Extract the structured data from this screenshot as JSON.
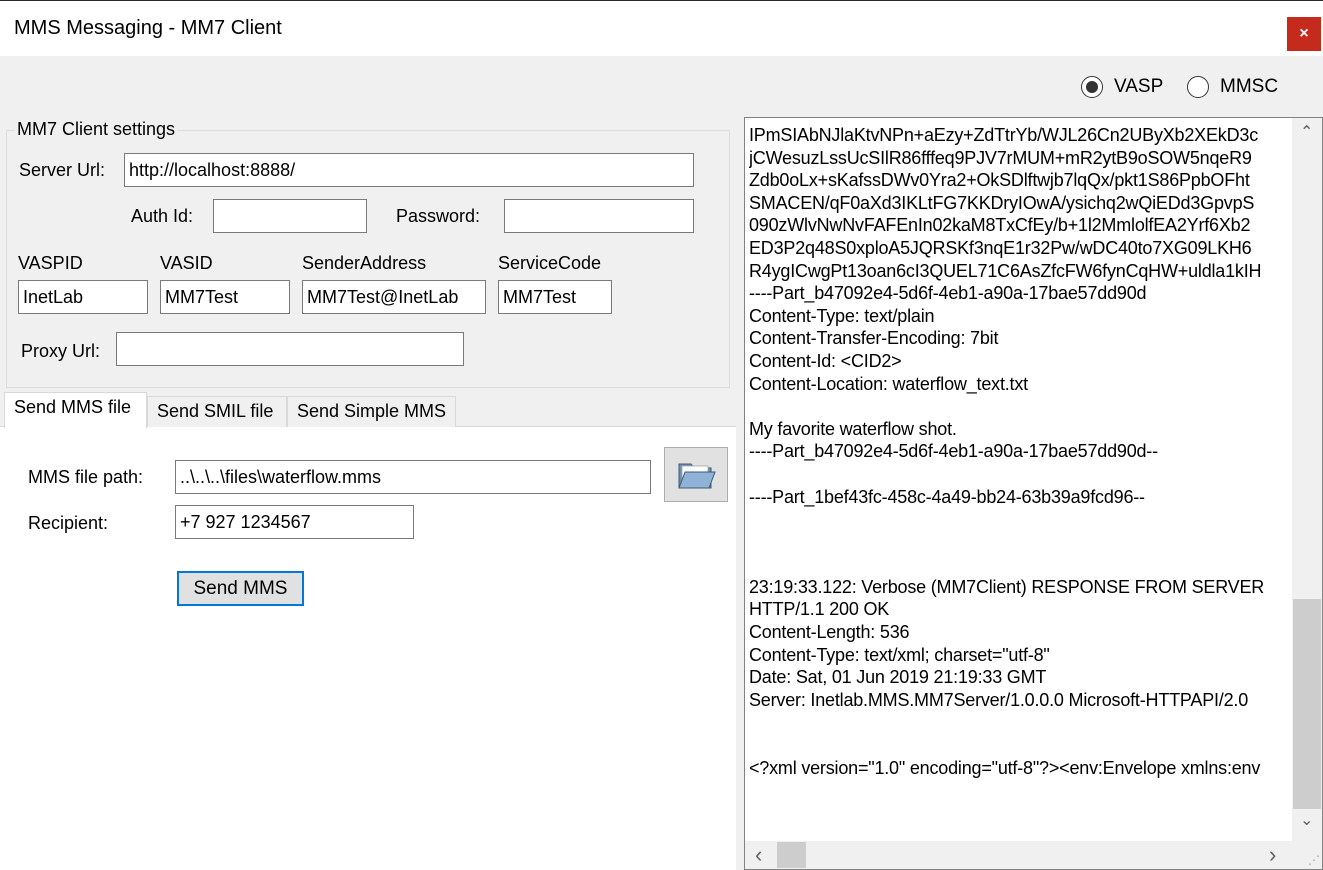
{
  "window": {
    "title": "MMS Messaging - MM7 Client",
    "close_glyph": "×"
  },
  "mode": {
    "selected": "VASP",
    "options": [
      {
        "label": "VASP",
        "checked": true
      },
      {
        "label": "MMSC",
        "checked": false
      }
    ]
  },
  "settings": {
    "group_label": "MM7 Client settings",
    "server_url_label": "Server Url:",
    "server_url_value": "http://localhost:8888/",
    "auth_id_label": "Auth Id:",
    "auth_id_value": "",
    "password_label": "Password:",
    "password_value": "",
    "vaspid_label": "VASPID",
    "vaspid_value": "InetLab",
    "vasid_label": "VASID",
    "vasid_value": "MM7Test",
    "sender_label": "SenderAddress",
    "sender_value": "MM7Test@InetLab",
    "service_label": "ServiceCode",
    "service_value": "MM7Test",
    "proxy_label": "Proxy Url:",
    "proxy_value": ""
  },
  "tabs": [
    {
      "label": "Send MMS file",
      "active": true
    },
    {
      "label": "Send SMIL file",
      "active": false
    },
    {
      "label": "Send Simple MMS",
      "active": false
    }
  ],
  "send_file": {
    "path_label": "MMS file path:",
    "path_value": "..\\..\\..\\files\\waterflow.mms",
    "recipient_label": "Recipient:",
    "recipient_value": "+7 927 1234567",
    "browse_icon": "open-folder-icon",
    "send_button": "Send MMS"
  },
  "log": {
    "lines": [
      "IPmSIAbNJlaKtvNPn+aEzy+ZdTtrYb/WJL26Cn2UByXb2XEkD3c",
      "jCWesuzLssUcSIlR86fffeq9PJV7rMUM+mR2ytB9oSOW5nqeR9",
      "Zdb0oLx+sKafssDWv0Yra2+OkSDlftwjb7lqQx/pkt1S86PpbOFht",
      "SMACEN/qF0aXd3IKLtFG7KKDryIOwA/ysichq2wQiEDd3GpvpS",
      "090zWlvNwNvFAFEnIn02kaM8TxCfEy/b+1l2MmlolfEA2Yrf6Xb2",
      "ED3P2q48S0xploA5JQRSKf3nqE1r32Pw/wDC40to7XG09LKH6",
      "R4ygICwgPt13oan6cI3QUEL71C6AsZfcFW6fynCqHW+uldla1kIH",
      "----Part_b47092e4-5d6f-4eb1-a90a-17bae57dd90d",
      "Content-Type: text/plain",
      "Content-Transfer-Encoding: 7bit",
      "Content-Id: <CID2>",
      "Content-Location: waterflow_text.txt",
      "",
      "My favorite waterflow shot.",
      "----Part_b47092e4-5d6f-4eb1-a90a-17bae57dd90d--",
      "",
      "----Part_1bef43fc-458c-4a49-bb24-63b39a9fcd96--",
      "",
      "",
      "",
      "23:19:33.122: Verbose (MM7Client) RESPONSE FROM SERVER",
      "HTTP/1.1 200 OK",
      "Content-Length: 536",
      "Content-Type: text/xml; charset=\"utf-8\"",
      "Date: Sat, 01 Jun 2019 21:19:33 GMT",
      "Server: Inetlab.MMS.MM7Server/1.0.0.0 Microsoft-HTTPAPI/2.0",
      "",
      "",
      "<?xml version=\"1.0\" encoding=\"utf-8\"?><env:Envelope xmlns:env"
    ],
    "scroll_up": "⌃",
    "scroll_down": "⌄",
    "scroll_left": "‹",
    "scroll_right": "›",
    "grip": "⋰"
  }
}
